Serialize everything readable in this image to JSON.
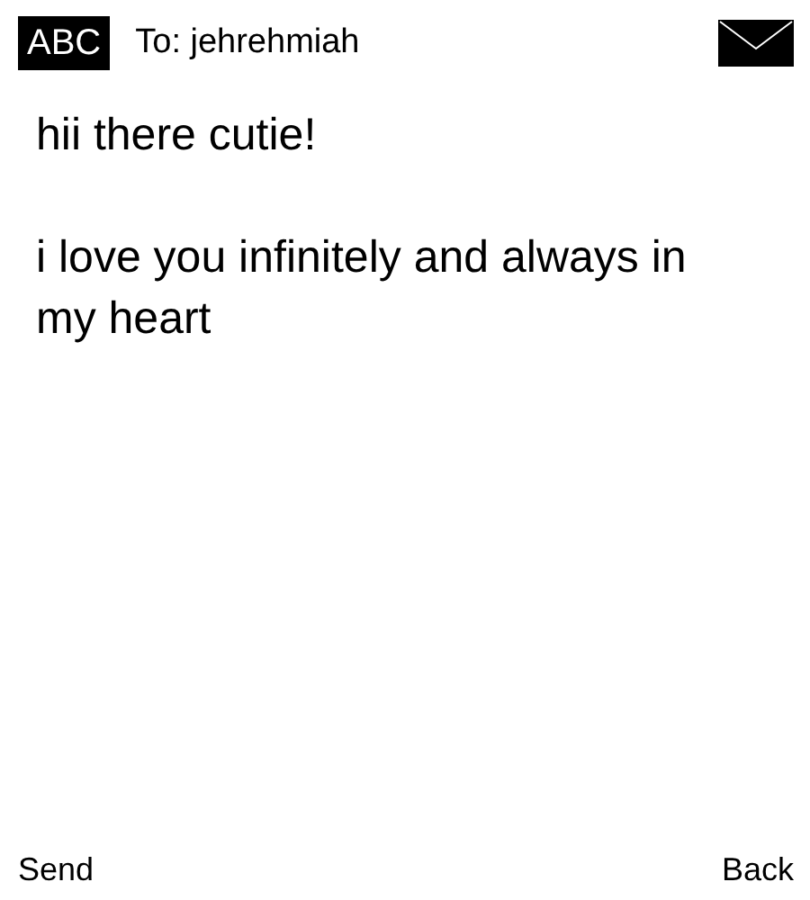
{
  "header": {
    "input_mode": "ABC",
    "recipient": "To: jehrehmiah"
  },
  "message": [
    "hii there cutie!",
    "i love you infinitely and always in my heart"
  ],
  "softkeys": {
    "left": "Send",
    "right": "Back"
  }
}
